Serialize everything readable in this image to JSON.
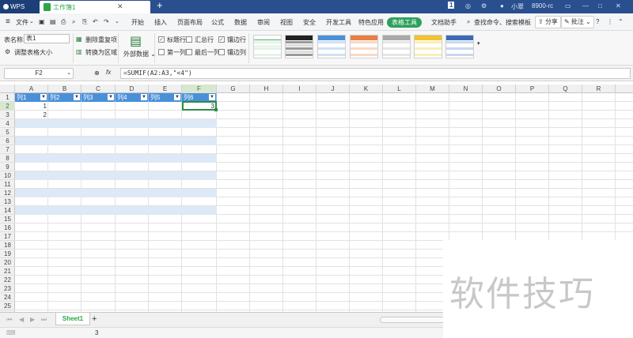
{
  "titlebar": {
    "app": "WPS",
    "doc_tab": "工作簿1",
    "new_tab": "+",
    "right": {
      "badge": "1",
      "user": "小翠",
      "extra": "8900-rc"
    }
  },
  "menu": {
    "file": "文件",
    "items": [
      "开始",
      "插入",
      "页面布局",
      "公式",
      "数据",
      "审阅",
      "视图",
      "安全",
      "开发工具",
      "特色应用"
    ],
    "active": "表格工具",
    "helper": "文档助手",
    "search": "查找命令、搜索模板",
    "share": "分享",
    "comment": "批注",
    "help": "?"
  },
  "toolbar": {
    "table_name_label": "表名称:",
    "table_name_value": "表1",
    "resize": "调整表格大小",
    "remove_dup": "删除重复项",
    "convert": "转换为区域",
    "external": "外部数据",
    "checks": [
      {
        "label": "标题行",
        "checked": true
      },
      {
        "label": "汇总行",
        "checked": false
      },
      {
        "label": "镶边行",
        "checked": true
      },
      {
        "label": "第一列",
        "checked": false
      },
      {
        "label": "最后一列",
        "checked": false
      },
      {
        "label": "镶边列",
        "checked": false
      }
    ]
  },
  "formula_bar": {
    "cell_ref": "F2",
    "fx": "fx",
    "formula": "=SUMIF(A2:A3,\"<4\")"
  },
  "grid": {
    "columns": [
      "A",
      "B",
      "C",
      "D",
      "E",
      "F",
      "G",
      "H",
      "I",
      "J",
      "K",
      "L",
      "M",
      "N",
      "O",
      "P",
      "Q",
      "R"
    ],
    "rows": [
      "1",
      "2",
      "3",
      "4",
      "5",
      "6",
      "7",
      "8",
      "9",
      "10",
      "11",
      "12",
      "13",
      "14",
      "15",
      "16",
      "17",
      "18",
      "19",
      "20",
      "21",
      "22",
      "23",
      "24",
      "25"
    ],
    "table_headers": [
      "列1",
      "列2",
      "列3",
      "列4",
      "列5",
      "列6"
    ],
    "values": {
      "A2": "1",
      "A3": "2",
      "F2": "3"
    }
  },
  "sheets": {
    "active": "Sheet1",
    "add": "+"
  },
  "status": {
    "value": "3"
  },
  "watermark": "软件技巧",
  "colors": {
    "titlebar": "#2a4f8f",
    "accent_green": "#2ca05a",
    "table_header": "#4a90d9",
    "table_band": "#dde9f6"
  }
}
